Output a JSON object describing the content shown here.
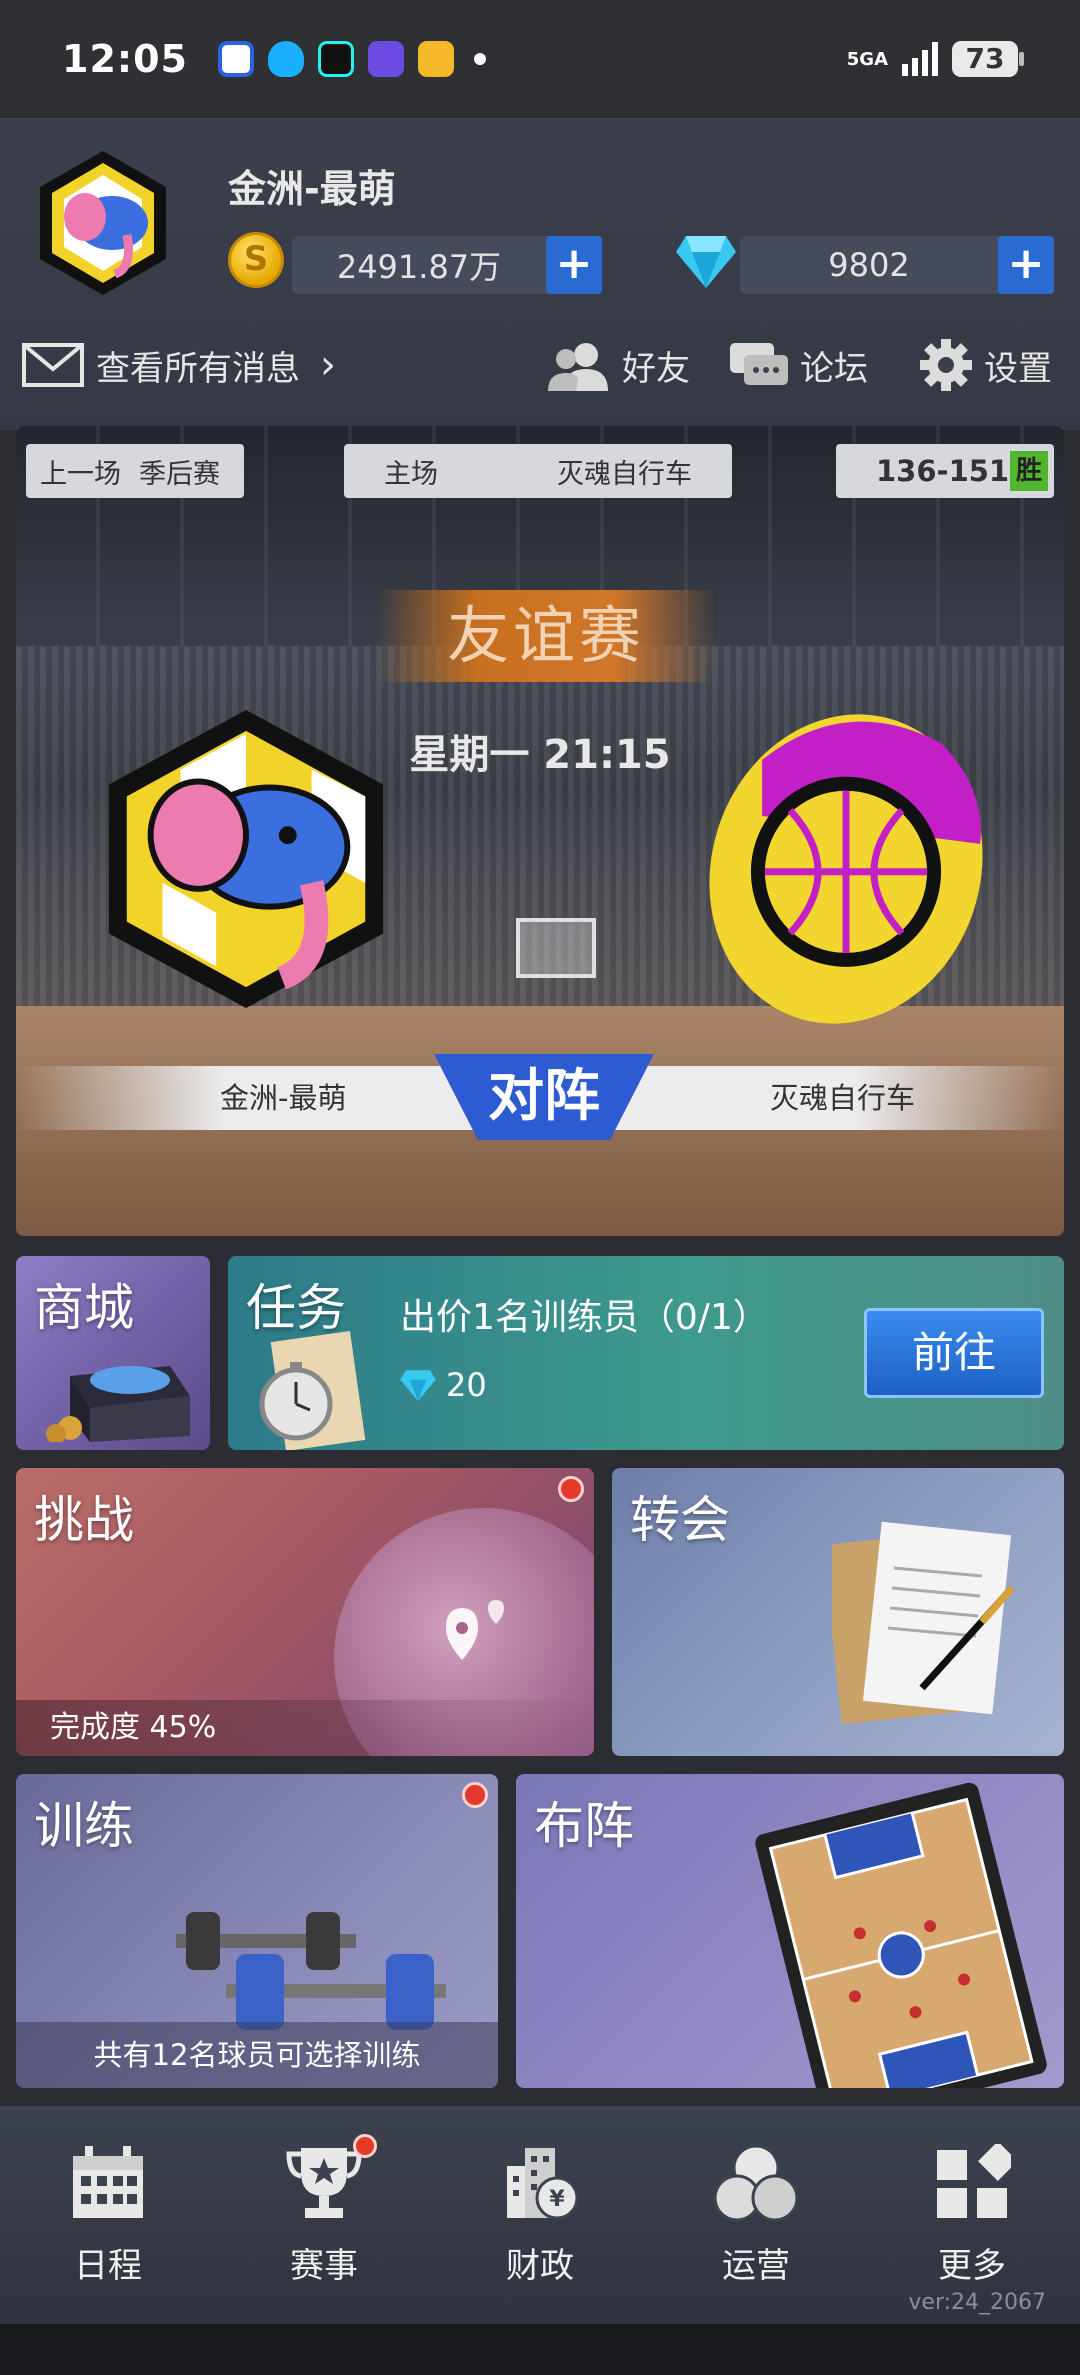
{
  "status_bar": {
    "time": "12:05",
    "network": "5GA",
    "battery": "73",
    "apps": [
      "baidu-icon",
      "qq-icon",
      "tiktok-icon",
      "tieba-icon",
      "weibo-icon"
    ]
  },
  "header": {
    "team_name": "金洲-最萌",
    "coins": "2491.87万",
    "gems": "9802",
    "coin_symbol": "S",
    "plus": "+",
    "messages_label": "查看所有消息",
    "messages_arrow": "›",
    "friends_label": "好友",
    "forum_label": "论坛",
    "settings_label": "设置"
  },
  "match": {
    "prev_label": "上一场",
    "prev_type": "季后赛",
    "venue": "主场",
    "prev_opponent": "灭魂自行车",
    "prev_score": "136-151",
    "prev_result": "胜",
    "match_type": "友谊赛",
    "time": "星期一 21:15",
    "home_team": "金洲-最萌",
    "away_team": "灭魂自行车",
    "vs_label": "对阵"
  },
  "tiles": {
    "shop": "商城",
    "task": "任务",
    "task_desc": "出价1名训练员（0/1）",
    "task_reward": "20",
    "task_button": "前往",
    "challenge": "挑战",
    "challenge_progress": "完成度 45%",
    "transfer": "转会",
    "training": "训练",
    "training_caption": "共有12名球员可选择训练",
    "formation": "布阵"
  },
  "bottom_nav": [
    {
      "label": "日程",
      "icon": "calendar-icon"
    },
    {
      "label": "赛事",
      "icon": "trophy-icon"
    },
    {
      "label": "财政",
      "icon": "finance-icon"
    },
    {
      "label": "运营",
      "icon": "operations-icon"
    },
    {
      "label": "更多",
      "icon": "more-icon"
    }
  ],
  "version": "ver:24_2067",
  "colors": {
    "accent_blue": "#2a6bd1",
    "badge_red": "#e43a2c",
    "win_green": "#52b530"
  }
}
